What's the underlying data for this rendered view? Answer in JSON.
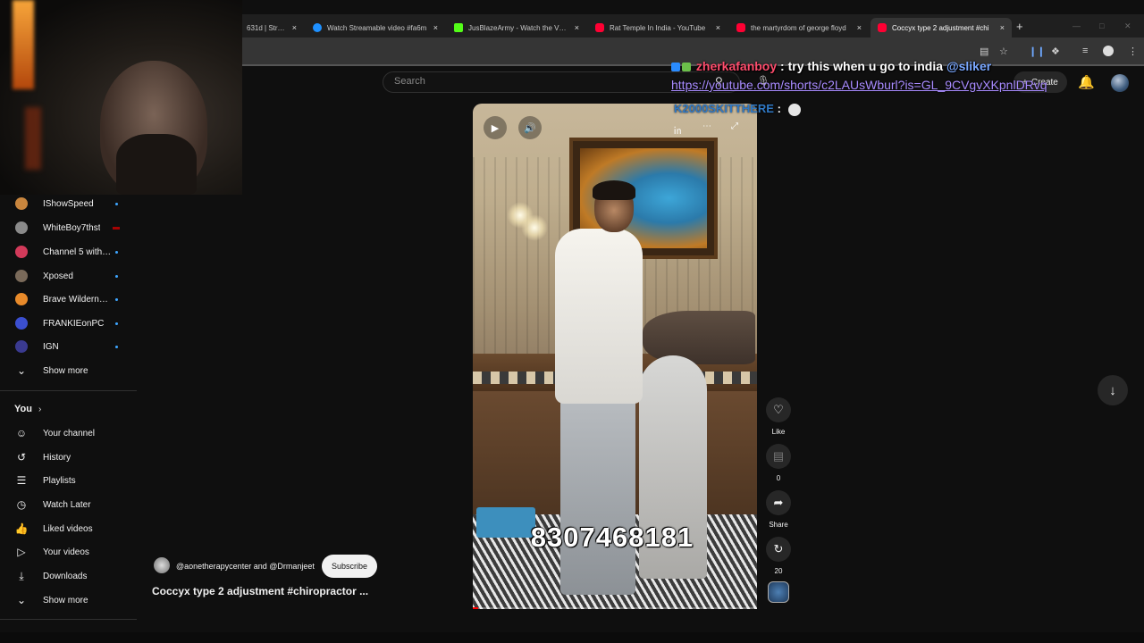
{
  "browser": {
    "tabs": [
      {
        "title": "631d | Stream",
        "favicon_color": "#6a4cff",
        "active": false
      },
      {
        "title": "Watch Streamable video #fa6m",
        "favicon_color": "#1e90ff",
        "active": false
      },
      {
        "title": "JusBlazeArmy - Watch the VOD",
        "favicon_color": "#53fc18",
        "active": false
      },
      {
        "title": "Rat Temple In India - YouTube",
        "favicon_color": "#ff0033",
        "active": false
      },
      {
        "title": "the martyrdom of george floyd",
        "favicon_color": "#ff0033",
        "active": false
      },
      {
        "title": "Coccyx type 2 adjustment #chi",
        "favicon_color": "#ff0033",
        "active": true
      }
    ],
    "new_tab_label": "+",
    "close_label": "×"
  },
  "header": {
    "search_placeholder": "Search",
    "create_label": "Create",
    "create_plus": "+"
  },
  "sidebar": {
    "subscriptions": [
      {
        "label": "IShowSpeed",
        "avatar_color": "#c9863e",
        "indicator": "dot"
      },
      {
        "label": "WhiteBoy7thst",
        "avatar_color": "#8a8a8a",
        "indicator": "live"
      },
      {
        "label": "Channel 5 with A...",
        "avatar_color": "#d23a5a",
        "indicator": "dot"
      },
      {
        "label": "Xposed",
        "avatar_color": "#7a6a5a",
        "indicator": "dot"
      },
      {
        "label": "Brave Wilderness",
        "avatar_color": "#e88a2a",
        "indicator": "dot"
      },
      {
        "label": "FRANKIEonPC",
        "avatar_color": "#3b4fd0",
        "indicator": "dot"
      },
      {
        "label": "IGN",
        "avatar_color": "#3a3a90",
        "indicator": "dot"
      }
    ],
    "show_more_1": "Show more",
    "you_heading": "You",
    "you_items": [
      {
        "label": "Your channel",
        "icon": "person-box-icon"
      },
      {
        "label": "History",
        "icon": "history-icon"
      },
      {
        "label": "Playlists",
        "icon": "playlists-icon"
      },
      {
        "label": "Watch Later",
        "icon": "clock-icon"
      },
      {
        "label": "Liked videos",
        "icon": "thumbs-up-icon"
      },
      {
        "label": "Your videos",
        "icon": "play-box-icon"
      },
      {
        "label": "Downloads",
        "icon": "download-icon"
      }
    ],
    "show_more_2": "Show more"
  },
  "player": {
    "overlay_number": "8307468181",
    "progress": 0.02
  },
  "actions": {
    "like_label": "Like",
    "comments_count": "0",
    "share_label": "Share",
    "remix_count": "20"
  },
  "channel": {
    "names": "@aonetherapycenter and @Drmanjeet",
    "subscribe_label": "Subscribe",
    "video_title": "Coccyx type 2 adjustment #chiropractor ..."
  },
  "chat": {
    "user1": "zherkafanboy",
    "separator": " : ",
    "message1": "try this when u go to india ",
    "mention1": "@sliker",
    "link1": "https://youtube.com/shorts/c2LAUsWburl?is=GL_9CVgvXKpnlDRvq",
    "user2": "K2000SKITTHERE",
    "separator2": " : "
  },
  "colors": {
    "background": "#0f0f0f",
    "accent_red": "#ff0033",
    "chat_user1": "#ff4d6d",
    "chat_user2": "#2f78c4",
    "chat_link": "#a88bff"
  }
}
